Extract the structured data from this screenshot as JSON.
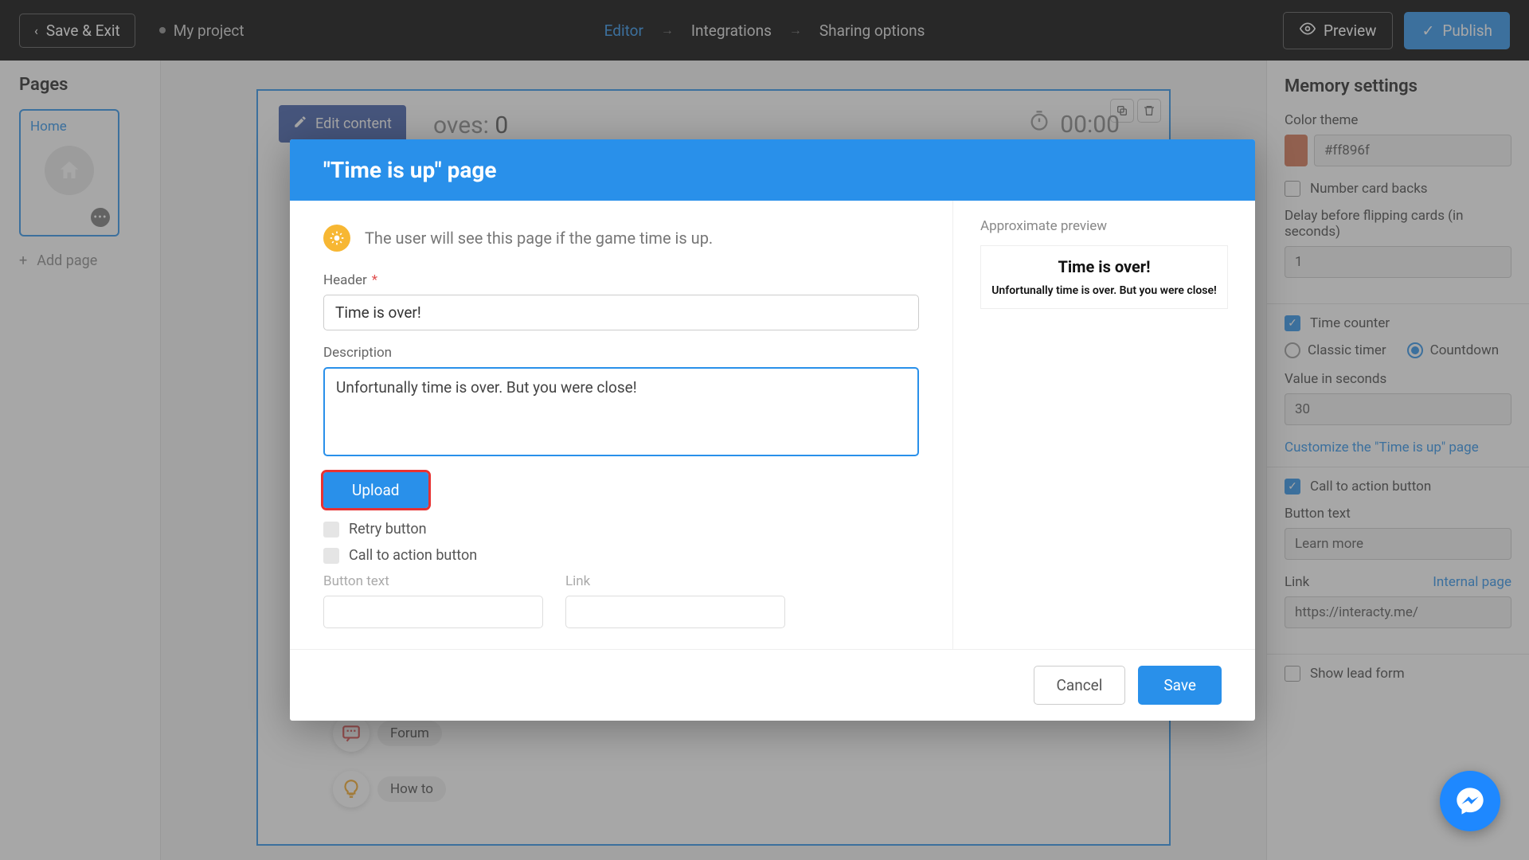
{
  "topbar": {
    "save_exit": "Save & Exit",
    "project": "My project",
    "nav": {
      "editor": "Editor",
      "integrations": "Integrations",
      "sharing": "Sharing options"
    },
    "preview": "Preview",
    "publish": "Publish"
  },
  "left": {
    "title": "Pages",
    "page1": "Home",
    "add_page": "Add page"
  },
  "canvas": {
    "edit_content": "Edit content",
    "moves_label": "oves:",
    "moves_value": "0",
    "timer": "00:00"
  },
  "help": {
    "forum": "Forum",
    "howto": "How to"
  },
  "right": {
    "title": "Memory settings",
    "color_theme": "Color theme",
    "color_hex": "#ff896f",
    "number_card_backs": "Number card backs",
    "delay_label": "Delay before flipping cards (in seconds)",
    "delay_value": "1",
    "time_counter": "Time counter",
    "classic_timer": "Classic timer",
    "countdown": "Countdown",
    "value_seconds_label": "Value in seconds",
    "value_seconds": "30",
    "customize_link": "Customize the \"Time is up\" page",
    "cta_checkbox": "Call to action button",
    "button_text_label": "Button text",
    "button_text": "Learn more",
    "link_label": "Link",
    "internal_page": "Internal page",
    "link_value": "https://interacty.me/",
    "show_lead": "Show lead form"
  },
  "modal": {
    "title": "\"Time is up\" page",
    "info": "The user will see this page if the game time is up.",
    "header_label": "Header",
    "header_value": "Time is over!",
    "description_label": "Description",
    "description_value": "Unfortunally time is over. But you were close!",
    "upload": "Upload",
    "retry": "Retry button",
    "cta": "Call to action button",
    "button_text_label": "Button text",
    "link_label": "Link",
    "preview_label": "Approximate preview",
    "preview_title": "Time is over!",
    "preview_desc": "Unfortunally time is over. But you were close!",
    "cancel": "Cancel",
    "save": "Save"
  }
}
